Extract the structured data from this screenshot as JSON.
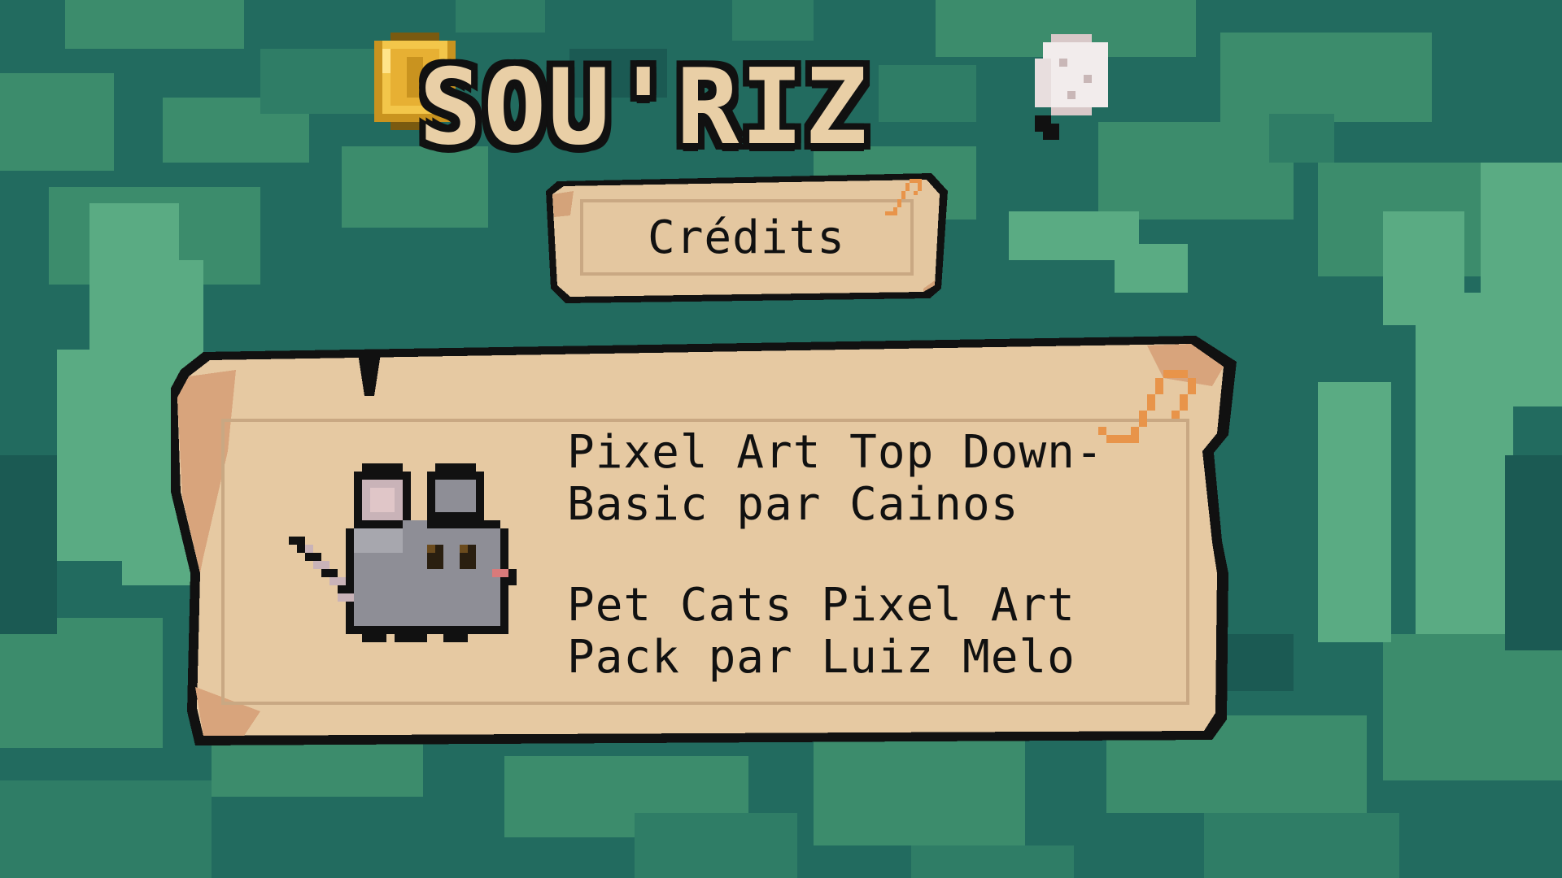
{
  "game": {
    "title": "SOU'RIZ"
  },
  "header": {
    "label": "Crédits"
  },
  "credits": [
    {
      "text": "Pixel Art Top Down-\nBasic par Cainos"
    },
    {
      "text": "Pet Cats Pixel Art\nPack par Luiz Melo"
    }
  ],
  "icons": {
    "coin": "coin-icon",
    "rice": "rice-ball-icon",
    "mouse": "mouse-sprite",
    "pin": "paperclip-icon"
  },
  "colors": {
    "background": "#226b5f",
    "parchment": "#e9cfa6",
    "outline": "#111111",
    "coin": "#f3c64a",
    "pin": "#e8944a"
  }
}
